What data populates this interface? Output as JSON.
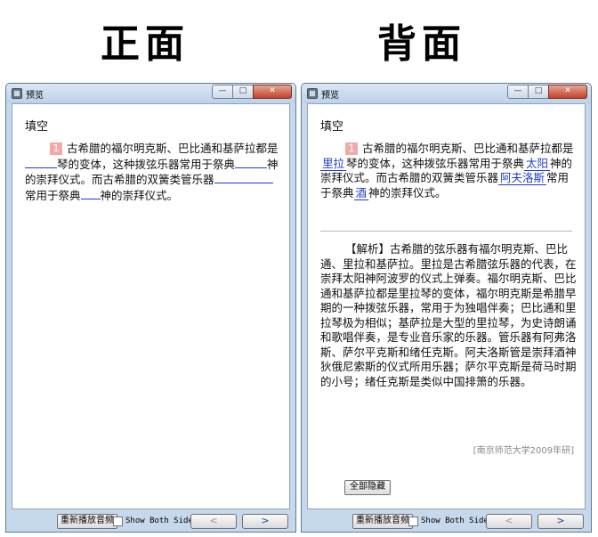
{
  "labels": {
    "front": "正面",
    "back": "背面"
  },
  "window": {
    "title": "预览",
    "controls": {
      "minimize": "—",
      "maximize": "□",
      "close": "✕"
    }
  },
  "question": {
    "heading": "填空",
    "number": "1",
    "parts": [
      "古希腊的福尔明克斯、巴比通和基萨拉都是",
      "琴的变体，这种拨弦乐器常用于祭典",
      "神的崇拜仪式。而古希腊的双簧类管乐器",
      "常用于祭典",
      "神的崇拜仪式。"
    ],
    "answers": [
      "里拉",
      "太阳",
      "阿夫洛斯",
      "酒"
    ]
  },
  "explanation": {
    "text": "【解析】古希腊的弦乐器有福尔明克斯、巴比通、里拉和基萨拉。里拉是古希腊弦乐器的代表，在崇拜太阳神阿波罗的仪式上弹奏。福尔明克斯、巴比通和基萨拉都是里拉琴的变体，福尔明克斯是希腊早期的一种拨弦乐器，常用于为独唱伴奏；巴比通和里拉琴极为相似；基萨拉是大型的里拉琴，为史诗朗诵和歌唱伴奏，是专业音乐家的乐器。管乐器有阿弗洛斯、萨尔平克斯和绪任克斯。阿夫洛斯管是崇拜酒神狄俄尼索斯的仪式所用乐器；萨尔平克斯是荷马时期的小号；绪任克斯是类似中国排箫的乐器。",
    "source": "[南京师范大学2009年研]"
  },
  "buttons": {
    "hide_all": "全部隐藏",
    "replay_audio": "重新播放音频",
    "show_both_sides": "Show Both Sides",
    "prev": "<",
    "next": ">"
  }
}
